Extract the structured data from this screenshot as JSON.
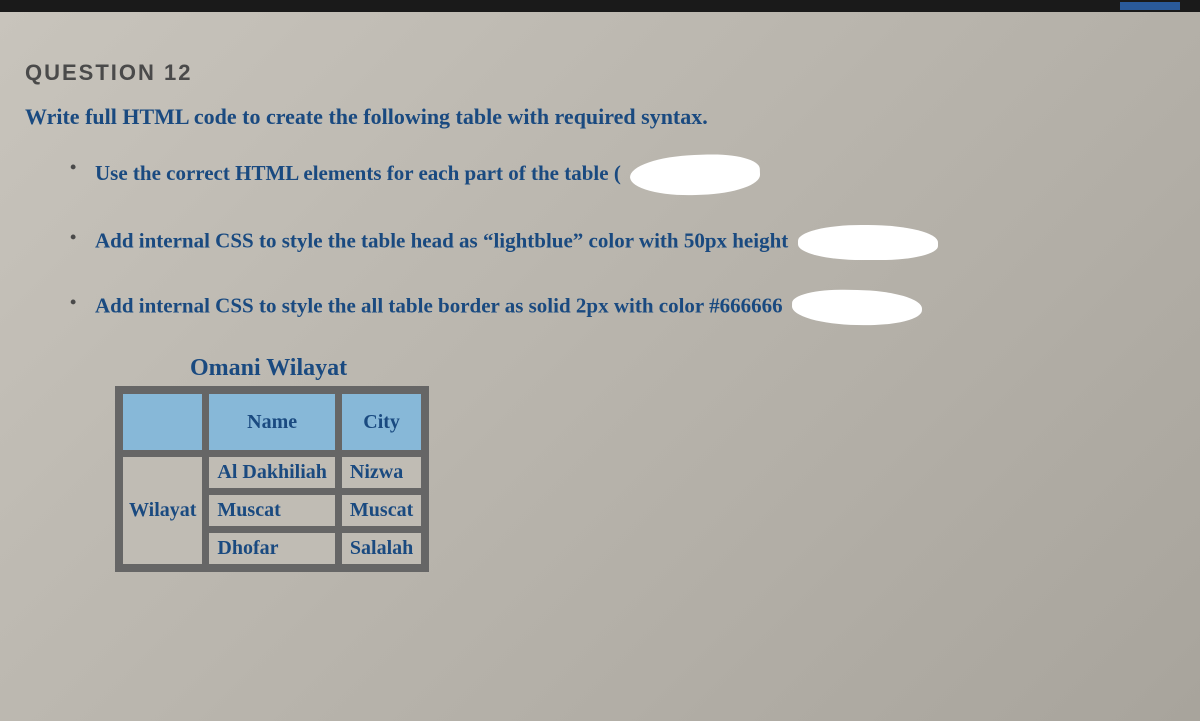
{
  "question": {
    "number": "QUESTION 12",
    "prompt": "Write full HTML code to create the following table with required syntax.",
    "bullets": [
      "Use the correct HTML elements for each part of the table (",
      "Add internal CSS to style the table head as “lightblue” color with 50px height",
      "Add internal CSS to style the all table border as solid 2px with color #666666"
    ]
  },
  "table": {
    "caption": "Omani Wilayat",
    "headers": {
      "col1": "",
      "col2": "Name",
      "col3": "City"
    },
    "row_header": "Wilayat",
    "rows": [
      {
        "name": "Al Dakhiliah",
        "city": "Nizwa"
      },
      {
        "name": "Muscat",
        "city": "Muscat"
      },
      {
        "name": "Dhofar",
        "city": "Salalah"
      }
    ]
  }
}
